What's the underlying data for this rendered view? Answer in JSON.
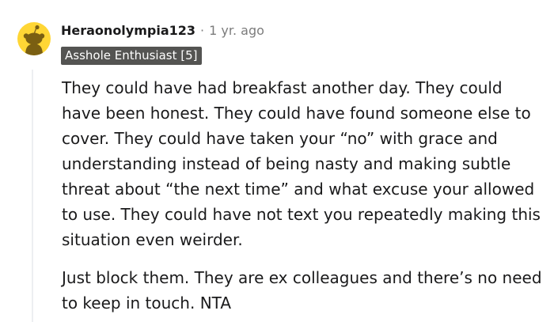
{
  "comment": {
    "username": "Heraonolympia123",
    "separator": "·",
    "timestamp": "1 yr. ago",
    "flair": "Asshole Enthusiast [5]",
    "avatar_icon": "snoo-avatar-icon",
    "paragraphs": [
      "They could have had breakfast another day. They could have been honest. They could have found someone else to cover. They could have taken your “no” with grace and understanding instead of being nasty and making subtle threat about “the next time” and what excuse your allowed to use. They could have not text you repeatedly making this situation even weirder.",
      "Just block them. They are ex colleagues and there’s no need to keep in touch. NTA"
    ]
  },
  "colors": {
    "avatar_bg": "#ffd635",
    "flair_bg": "#545452",
    "flair_text": "#ffffff",
    "meta_gray": "#7c7c7c",
    "thread_line": "#edeff1"
  }
}
